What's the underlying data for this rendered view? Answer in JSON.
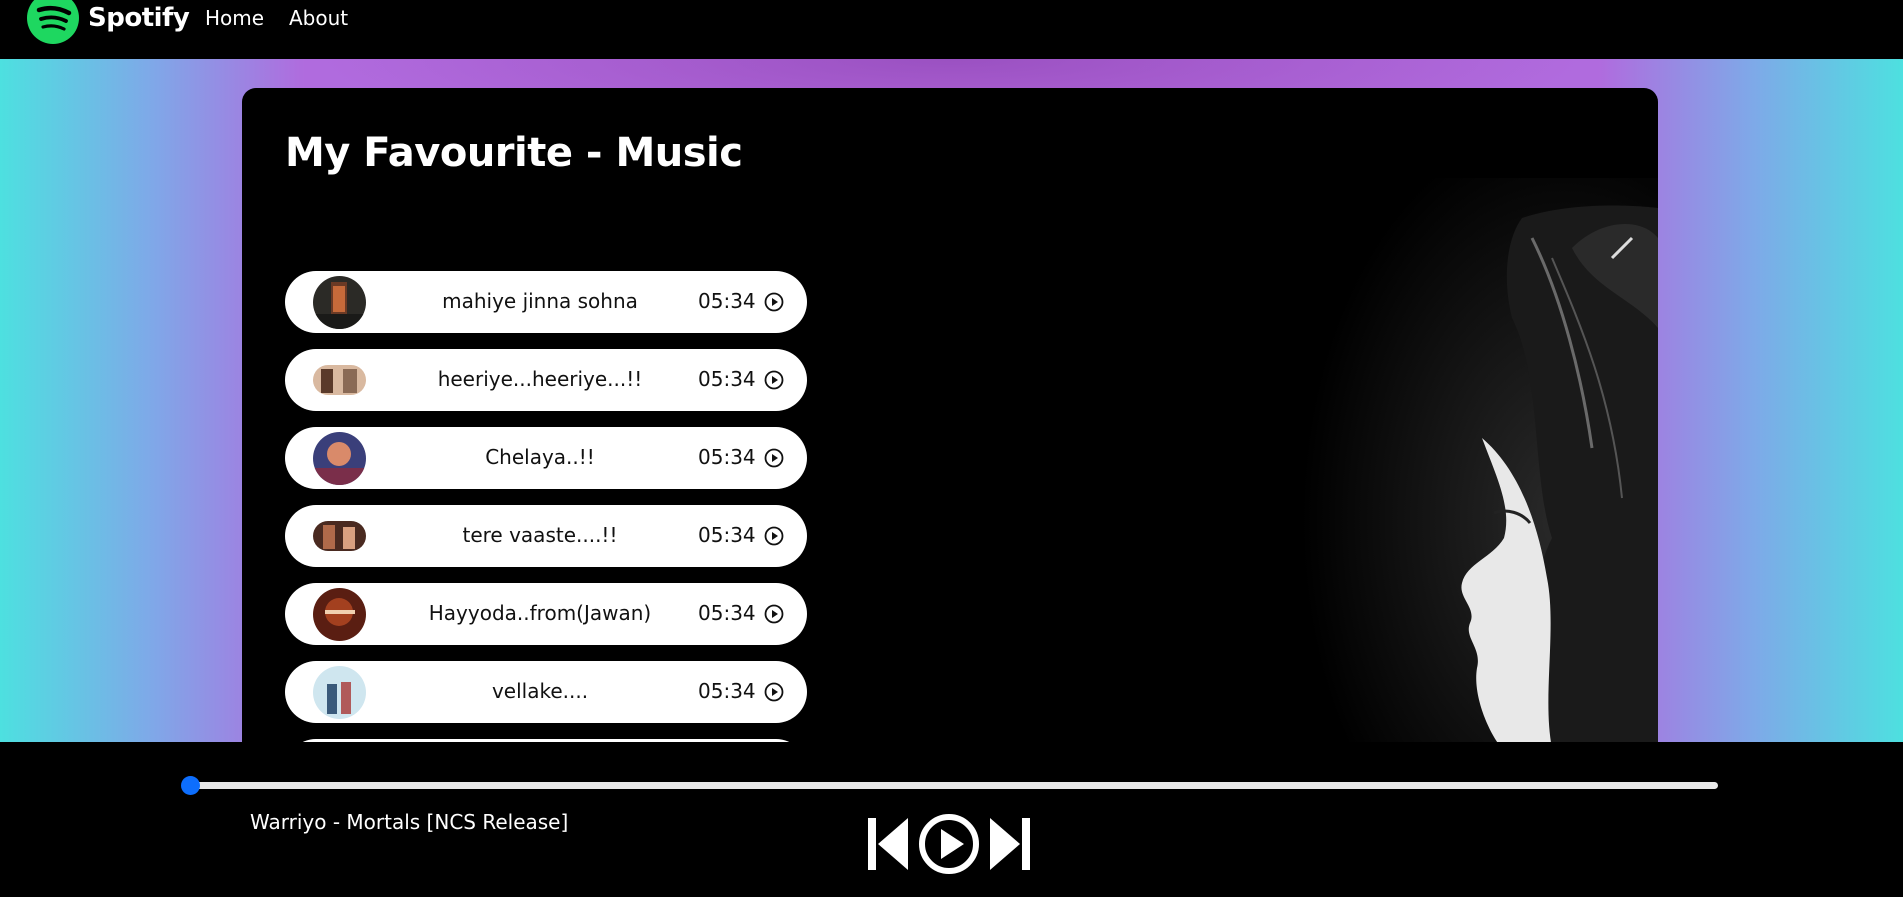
{
  "nav": {
    "brand": "Spotify",
    "links": [
      "Home",
      "About"
    ]
  },
  "main": {
    "title": "My Favourite - Music",
    "songs": [
      {
        "name": "mahiye jinna sohna",
        "duration": "05:34"
      },
      {
        "name": "heeriye...heeriye...!!",
        "duration": "05:34"
      },
      {
        "name": "Chelaya..!!",
        "duration": "05:34"
      },
      {
        "name": "tere vaaste....!!",
        "duration": "05:34"
      },
      {
        "name": "Hayyoda..from(Jawan)",
        "duration": "05:34"
      },
      {
        "name": "vellake....",
        "duration": "05:34"
      }
    ]
  },
  "player": {
    "now_playing": "Warriyo - Mortals [NCS Release]",
    "progress_percent": 0
  },
  "colors": {
    "brand_green": "#1ed760",
    "accent_blue": "#0d6efd"
  },
  "icons": [
    "spotify-logo-icon",
    "play-circle-icon",
    "skip-back-icon",
    "play-button-icon",
    "skip-forward-icon"
  ]
}
